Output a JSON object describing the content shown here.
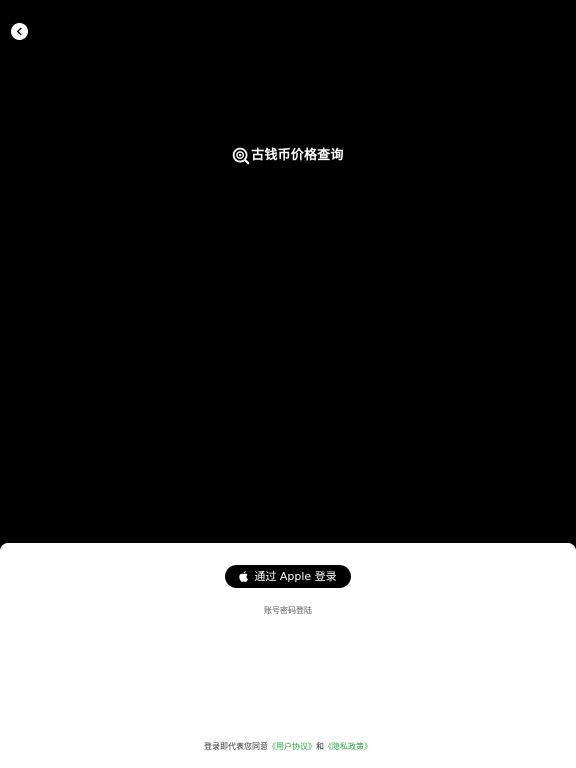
{
  "header": {
    "back_icon": "chevron-left-icon"
  },
  "brand": {
    "icon": "magnifier-coin-icon",
    "title": "古钱币价格查询"
  },
  "login": {
    "apple_icon": "apple-logo-icon",
    "apple_button_label": "通过 Apple 登录",
    "account_login_label": "账号密码登陆"
  },
  "agreement": {
    "prefix": "登录即代表您同意",
    "user_agreement": "《用户协议》",
    "conjunction": "和",
    "privacy_policy": "《隐私政策》"
  },
  "colors": {
    "background": "#000000",
    "sheet": "#ffffff",
    "link": "#2ba84a",
    "apple_button": "#000000"
  }
}
